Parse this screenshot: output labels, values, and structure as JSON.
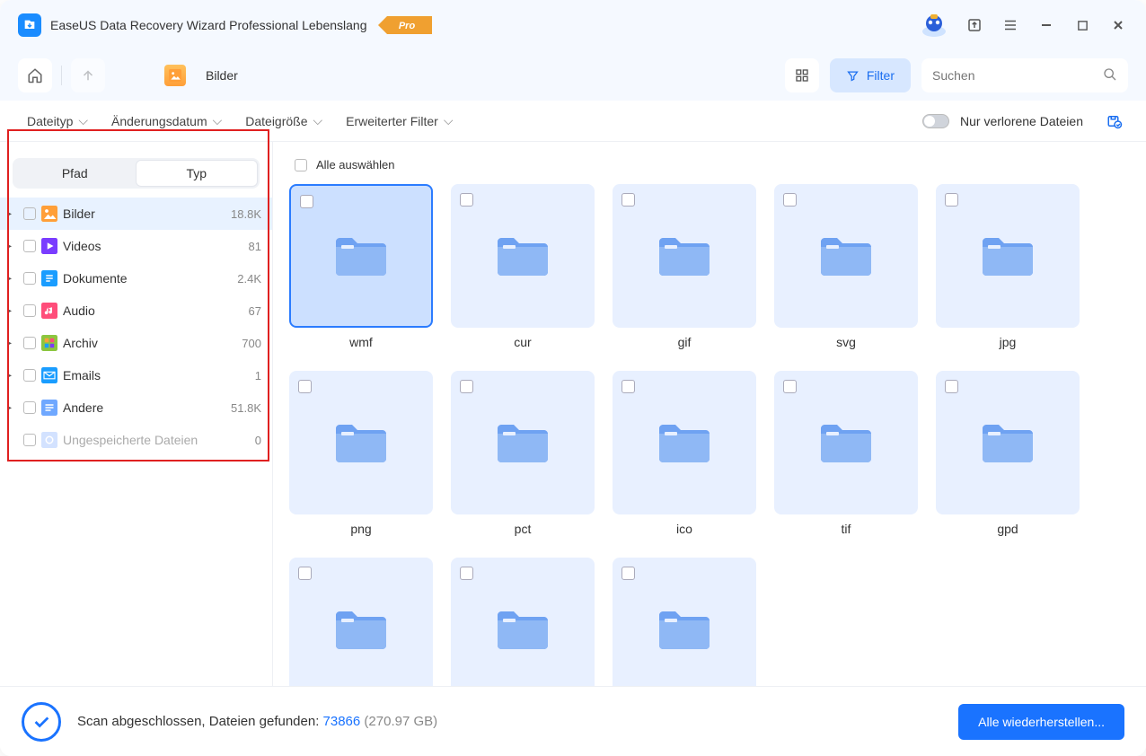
{
  "app": {
    "title": "EaseUS Data Recovery Wizard Professional Lebenslang",
    "pro_label": "Pro"
  },
  "toolbar": {
    "breadcrumb_label": "Bilder",
    "filter_label": "Filter",
    "search_placeholder": "Suchen"
  },
  "filterbar": {
    "items": [
      "Dateityp",
      "Änderungsdatum",
      "Dateigröße",
      "Erweiterter Filter"
    ],
    "lost_only": "Nur verlorene Dateien"
  },
  "sidebar": {
    "tabs": {
      "path": "Pfad",
      "type": "Typ"
    },
    "tree": [
      {
        "icon": "image",
        "color": "#ff9f38",
        "label": "Bilder",
        "count": "18.8K",
        "active": true
      },
      {
        "icon": "video",
        "color": "#7a3cff",
        "label": "Videos",
        "count": "81"
      },
      {
        "icon": "doc",
        "color": "#1a9dff",
        "label": "Dokumente",
        "count": "2.4K"
      },
      {
        "icon": "audio",
        "color": "#ff4d7a",
        "label": "Audio",
        "count": "67"
      },
      {
        "icon": "archive",
        "color": "#8cc63f",
        "label": "Archiv",
        "count": "700"
      },
      {
        "icon": "email",
        "color": "#1a9dff",
        "label": "Emails",
        "count": "1"
      },
      {
        "icon": "other",
        "color": "#6fa8ff",
        "label": "Andere",
        "count": "51.8K"
      },
      {
        "icon": "unsaved",
        "color": "#a8c6ff",
        "label": "Ungespeicherte Dateien",
        "count": "0",
        "disabled": true
      }
    ]
  },
  "content": {
    "select_all": "Alle auswählen",
    "folders": [
      "wmf",
      "cur",
      "gif",
      "svg",
      "jpg",
      "png",
      "pct",
      "ico",
      "tif",
      "gpd",
      "",
      "",
      ""
    ]
  },
  "status": {
    "prefix": "Scan abgeschlossen, Dateien gefunden: ",
    "count": "73866",
    "size": " (270.97 GB)",
    "recover_label": "Alle wiederherstellen..."
  }
}
